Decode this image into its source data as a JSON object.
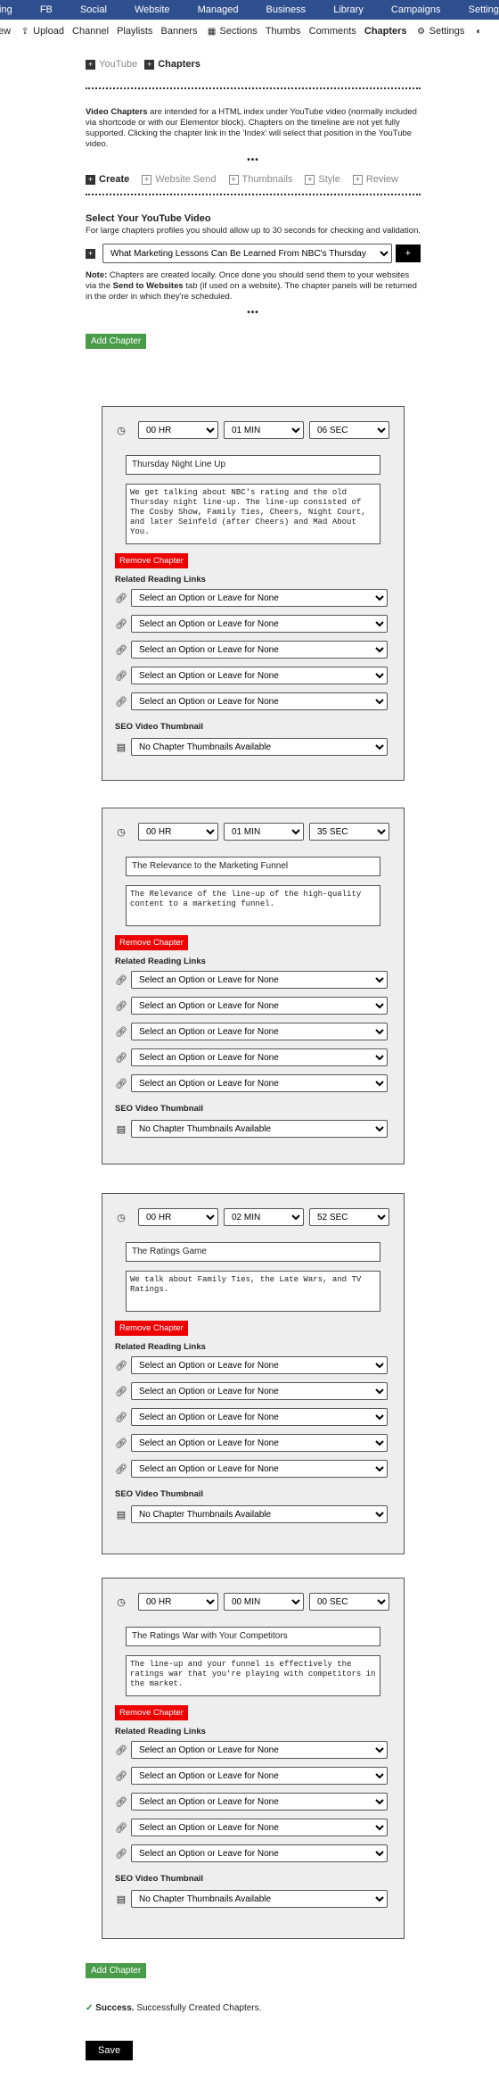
{
  "topnav": [
    "ting",
    "FB",
    "Social",
    "Website",
    "Managed",
    "Business",
    "Library",
    "Campaigns",
    "Settings"
  ],
  "subnav": {
    "items": [
      "ew",
      "Upload",
      "Channel",
      "Playlists",
      "Banners",
      "Sections",
      "Thumbs",
      "Comments",
      "Chapters",
      "Settings"
    ]
  },
  "tabs_top": {
    "youtube": "YouTube",
    "chapters": "Chapters"
  },
  "intro": {
    "bold": "Video Chapters",
    "text": " are intended for a HTML index under YouTube video (normally included via shortcode or with our Elementor block). Chapters on the timeline are not yet fully supported. Clicking the chapter link in the 'Index' will select that position in the YouTube video."
  },
  "dots": "•••",
  "steps": [
    "Create",
    "Website Send",
    "Thumbnails",
    "Style",
    "Review"
  ],
  "select_video": {
    "title": "Select Your YouTube Video",
    "hint": "For large chapters profiles you should allow up to 30 seconds for checking and validation.",
    "value": "What Marketing Lessons Can Be Learned From NBC's Thursday",
    "add": "+"
  },
  "note": {
    "bold": "Note:",
    "text1": " Chapters are created locally. Once done you should send them to your websites via the ",
    "bold2": "Send to Websites",
    "text2": " tab (if used on a website). The chapter panels will be returned in the order in which they're scheduled."
  },
  "add_chapter": "Add Chapter",
  "remove_chapter": "Remove Chapter",
  "related_label": "Related Reading Links",
  "link_placeholder": "Select an Option or Leave for None",
  "seo_label": "SEO Video Thumbnail",
  "thumb_value": "No Chapter Thumbnails Available",
  "chapters": [
    {
      "hr": "00 HR",
      "min": "01 MIN",
      "sec": "06 SEC",
      "title": "Thursday Night Line Up",
      "desc": "We get talking about NBC's rating and the old Thursday night line-up. The line-up consisted of The Cosby Show, Family Ties, Cheers, Night Court, and later Seinfeld (after Cheers) and Mad About You."
    },
    {
      "hr": "00 HR",
      "min": "01 MIN",
      "sec": "35 SEC",
      "title": "The Relevance to the Marketing Funnel",
      "desc": "The Relevance of the line-up of the high-quality content to a marketing funnel."
    },
    {
      "hr": "00 HR",
      "min": "02 MIN",
      "sec": "52 SEC",
      "title": "The Ratings Game",
      "desc": "We talk about Family Ties, the Late Wars, and TV Ratings."
    },
    {
      "hr": "00 HR",
      "min": "00 MIN",
      "sec": "00 SEC",
      "title": "The Ratings War with Your Competitors",
      "desc": "The line-up and your funnel is effectively the ratings war that you're playing with competitors in the market."
    }
  ],
  "success": {
    "bold": "Success.",
    "text": " Successfully Created Chapters."
  },
  "save": "Save"
}
